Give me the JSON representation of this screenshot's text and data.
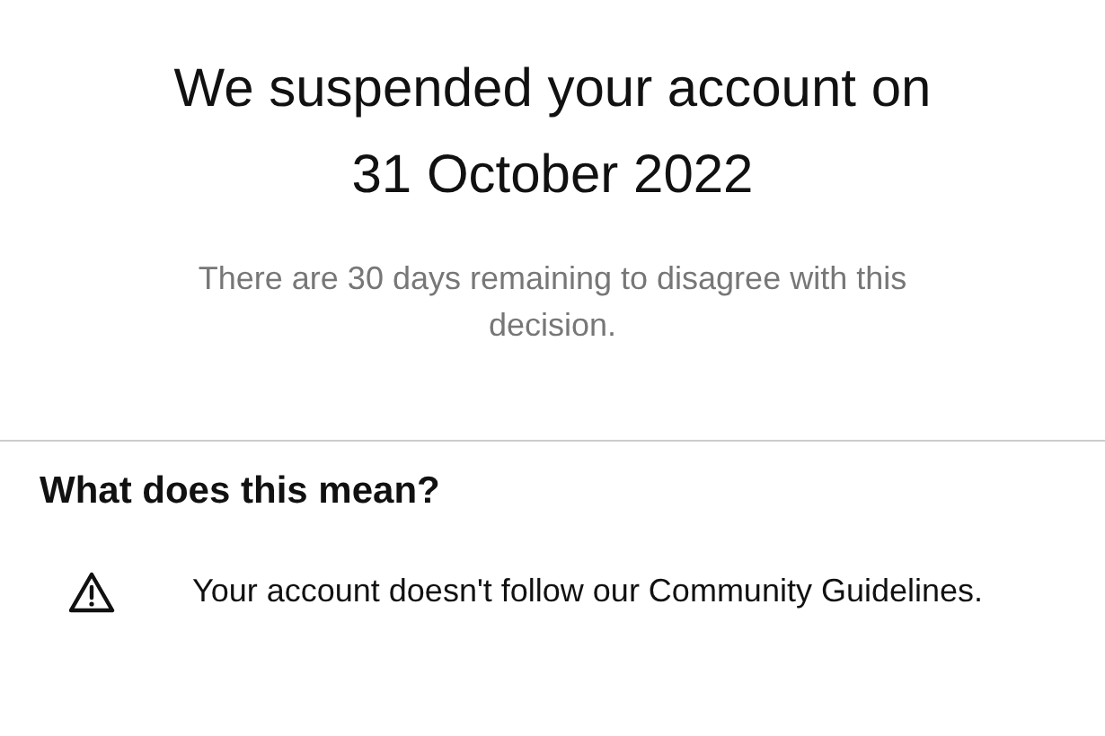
{
  "title": "We suspended your account on 31 October 2022",
  "subtitle": "There are 30 days remaining to disagree with this decision.",
  "section": {
    "heading": "What does this mean?",
    "items": [
      {
        "kind": "warning",
        "text": "Your account doesn't follow our Community Guidelines."
      }
    ]
  }
}
